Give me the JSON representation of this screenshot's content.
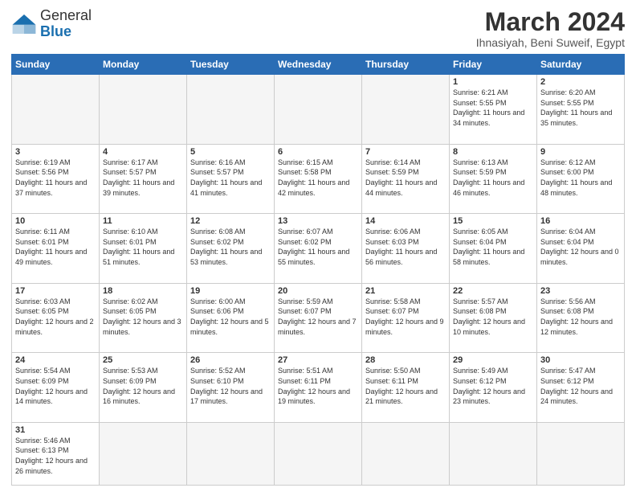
{
  "header": {
    "logo_general": "General",
    "logo_blue": "Blue",
    "month_year": "March 2024",
    "location": "Ihnasiyah, Beni Suweif, Egypt"
  },
  "days_of_week": [
    "Sunday",
    "Monday",
    "Tuesday",
    "Wednesday",
    "Thursday",
    "Friday",
    "Saturday"
  ],
  "weeks": [
    [
      {
        "day": "",
        "info": ""
      },
      {
        "day": "",
        "info": ""
      },
      {
        "day": "",
        "info": ""
      },
      {
        "day": "",
        "info": ""
      },
      {
        "day": "",
        "info": ""
      },
      {
        "day": "1",
        "info": "Sunrise: 6:21 AM\nSunset: 5:55 PM\nDaylight: 11 hours and 34 minutes."
      },
      {
        "day": "2",
        "info": "Sunrise: 6:20 AM\nSunset: 5:55 PM\nDaylight: 11 hours and 35 minutes."
      }
    ],
    [
      {
        "day": "3",
        "info": "Sunrise: 6:19 AM\nSunset: 5:56 PM\nDaylight: 11 hours and 37 minutes."
      },
      {
        "day": "4",
        "info": "Sunrise: 6:17 AM\nSunset: 5:57 PM\nDaylight: 11 hours and 39 minutes."
      },
      {
        "day": "5",
        "info": "Sunrise: 6:16 AM\nSunset: 5:57 PM\nDaylight: 11 hours and 41 minutes."
      },
      {
        "day": "6",
        "info": "Sunrise: 6:15 AM\nSunset: 5:58 PM\nDaylight: 11 hours and 42 minutes."
      },
      {
        "day": "7",
        "info": "Sunrise: 6:14 AM\nSunset: 5:59 PM\nDaylight: 11 hours and 44 minutes."
      },
      {
        "day": "8",
        "info": "Sunrise: 6:13 AM\nSunset: 5:59 PM\nDaylight: 11 hours and 46 minutes."
      },
      {
        "day": "9",
        "info": "Sunrise: 6:12 AM\nSunset: 6:00 PM\nDaylight: 11 hours and 48 minutes."
      }
    ],
    [
      {
        "day": "10",
        "info": "Sunrise: 6:11 AM\nSunset: 6:01 PM\nDaylight: 11 hours and 49 minutes."
      },
      {
        "day": "11",
        "info": "Sunrise: 6:10 AM\nSunset: 6:01 PM\nDaylight: 11 hours and 51 minutes."
      },
      {
        "day": "12",
        "info": "Sunrise: 6:08 AM\nSunset: 6:02 PM\nDaylight: 11 hours and 53 minutes."
      },
      {
        "day": "13",
        "info": "Sunrise: 6:07 AM\nSunset: 6:02 PM\nDaylight: 11 hours and 55 minutes."
      },
      {
        "day": "14",
        "info": "Sunrise: 6:06 AM\nSunset: 6:03 PM\nDaylight: 11 hours and 56 minutes."
      },
      {
        "day": "15",
        "info": "Sunrise: 6:05 AM\nSunset: 6:04 PM\nDaylight: 11 hours and 58 minutes."
      },
      {
        "day": "16",
        "info": "Sunrise: 6:04 AM\nSunset: 6:04 PM\nDaylight: 12 hours and 0 minutes."
      }
    ],
    [
      {
        "day": "17",
        "info": "Sunrise: 6:03 AM\nSunset: 6:05 PM\nDaylight: 12 hours and 2 minutes."
      },
      {
        "day": "18",
        "info": "Sunrise: 6:02 AM\nSunset: 6:05 PM\nDaylight: 12 hours and 3 minutes."
      },
      {
        "day": "19",
        "info": "Sunrise: 6:00 AM\nSunset: 6:06 PM\nDaylight: 12 hours and 5 minutes."
      },
      {
        "day": "20",
        "info": "Sunrise: 5:59 AM\nSunset: 6:07 PM\nDaylight: 12 hours and 7 minutes."
      },
      {
        "day": "21",
        "info": "Sunrise: 5:58 AM\nSunset: 6:07 PM\nDaylight: 12 hours and 9 minutes."
      },
      {
        "day": "22",
        "info": "Sunrise: 5:57 AM\nSunset: 6:08 PM\nDaylight: 12 hours and 10 minutes."
      },
      {
        "day": "23",
        "info": "Sunrise: 5:56 AM\nSunset: 6:08 PM\nDaylight: 12 hours and 12 minutes."
      }
    ],
    [
      {
        "day": "24",
        "info": "Sunrise: 5:54 AM\nSunset: 6:09 PM\nDaylight: 12 hours and 14 minutes."
      },
      {
        "day": "25",
        "info": "Sunrise: 5:53 AM\nSunset: 6:09 PM\nDaylight: 12 hours and 16 minutes."
      },
      {
        "day": "26",
        "info": "Sunrise: 5:52 AM\nSunset: 6:10 PM\nDaylight: 12 hours and 17 minutes."
      },
      {
        "day": "27",
        "info": "Sunrise: 5:51 AM\nSunset: 6:11 PM\nDaylight: 12 hours and 19 minutes."
      },
      {
        "day": "28",
        "info": "Sunrise: 5:50 AM\nSunset: 6:11 PM\nDaylight: 12 hours and 21 minutes."
      },
      {
        "day": "29",
        "info": "Sunrise: 5:49 AM\nSunset: 6:12 PM\nDaylight: 12 hours and 23 minutes."
      },
      {
        "day": "30",
        "info": "Sunrise: 5:47 AM\nSunset: 6:12 PM\nDaylight: 12 hours and 24 minutes."
      }
    ],
    [
      {
        "day": "31",
        "info": "Sunrise: 5:46 AM\nSunset: 6:13 PM\nDaylight: 12 hours and 26 minutes."
      },
      {
        "day": "",
        "info": ""
      },
      {
        "day": "",
        "info": ""
      },
      {
        "day": "",
        "info": ""
      },
      {
        "day": "",
        "info": ""
      },
      {
        "day": "",
        "info": ""
      },
      {
        "day": "",
        "info": ""
      }
    ]
  ]
}
